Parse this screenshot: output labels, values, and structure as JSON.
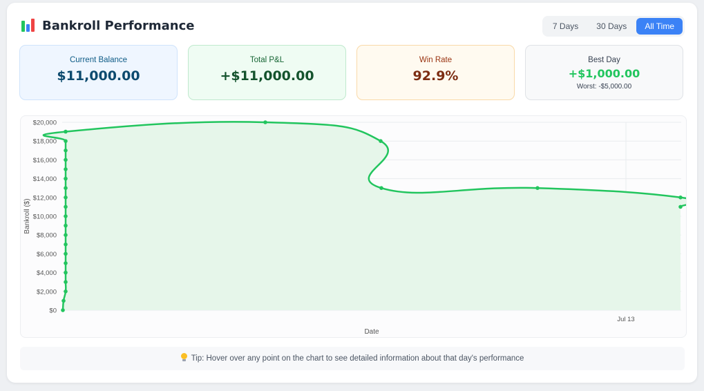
{
  "header": {
    "title": "Bankroll Performance",
    "icon": "bar-chart-icon"
  },
  "range": {
    "options": [
      "7 Days",
      "30 Days",
      "All Time"
    ],
    "selected": "All Time"
  },
  "stats": {
    "balance": {
      "label": "Current Balance",
      "value": "$11,000.00"
    },
    "pnl": {
      "label": "Total P&L",
      "value": "+$11,000.00"
    },
    "winrate": {
      "label": "Win Rate",
      "value": "92.9%"
    },
    "bestday": {
      "label": "Best Day",
      "value": "+$1,000.00",
      "sub": "Worst: -$5,000.00"
    }
  },
  "chart_data": {
    "type": "area",
    "xlabel": "Date",
    "ylabel": "Bankroll ($)",
    "ylim": [
      0,
      20000
    ],
    "y_ticks": [
      "$0",
      "$2,000",
      "$4,000",
      "$6,000",
      "$8,000",
      "$10,000",
      "$12,000",
      "$14,000",
      "$16,000",
      "$18,000",
      "$20,000"
    ],
    "x_tick_labels": [
      "Jul 13"
    ],
    "grid": true,
    "series": [
      {
        "values": [
          0,
          1000,
          2000,
          3000,
          4000,
          5000,
          6000,
          7000,
          8000,
          9000,
          10000,
          11000,
          12000,
          13000,
          14000,
          15000,
          16000,
          17000,
          18000,
          19000,
          20000,
          18000,
          13000,
          13000,
          12000,
          11000
        ]
      }
    ],
    "colors": {
      "line": "#22c55e",
      "fill": "#e6f6ea"
    }
  },
  "tip": {
    "text": "Tip: Hover over any point on the chart to see detailed information about that day's performance",
    "icon": "lightbulb-icon"
  }
}
